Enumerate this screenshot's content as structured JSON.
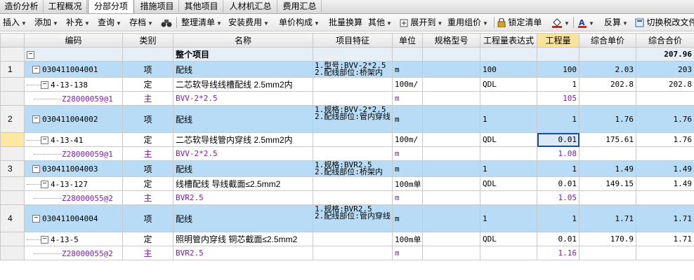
{
  "tabs": [
    "造价分析",
    "工程概况",
    "分部分项",
    "措施项目",
    "其他项目",
    "人材机汇总",
    "费用汇总"
  ],
  "active_tab": 2,
  "toolbar": {
    "insert": "插入",
    "add": "添加",
    "supplement": "补充",
    "query": "查询",
    "archive": "存档",
    "organize": "整理清单",
    "install_fee": "安装费用",
    "unit_composition": "单价构成",
    "batch_convert": "批量换算",
    "other": "其他",
    "expand": "展开到",
    "reuse": "重用组价",
    "lock": "锁定清单",
    "reverse": "反算",
    "switch_tax": "切换税改文件"
  },
  "columns": [
    "编码",
    "类别",
    "名称",
    "项目特征",
    "单位",
    "规格型号",
    "工程量表达式",
    "工程量",
    "综合单价",
    "综合合价"
  ],
  "whole_project": {
    "label": "整个项目",
    "total": "207.96"
  },
  "rows": [
    {
      "num": "1",
      "code": "030411004001",
      "type": "项",
      "name": "配线",
      "feat1": "1.型号:BVV-2*2.5",
      "feat2": "2.配线部位:桥架内",
      "unit": "m",
      "expr": "100",
      "qty": "100",
      "price": "2.03",
      "total": "203"
    },
    {
      "code": "4-13-138",
      "type": "定",
      "name": "二芯软导线线槽配线 2.5mm2内",
      "unit": "100m/",
      "expr": "QDL",
      "qty": "1",
      "price": "202.8",
      "total": "202.8"
    },
    {
      "code": "Z28000059@1",
      "type": "主",
      "name": "BVV-2*2.5",
      "unit": "m",
      "qty": "105"
    },
    {
      "num": "2",
      "code": "030411004002",
      "type": "项",
      "name": "配线",
      "feat1": "1.规格:BVV-2*2.5",
      "feat2": "2.配线部位:管内穿线",
      "unit": "m",
      "expr": "1",
      "qty": "1",
      "price": "1.76",
      "total": "1.76"
    },
    {
      "code": "4-13-41",
      "type": "定",
      "name": "二芯软导线管内穿线 2.5mm2内",
      "unit": "100m/",
      "expr": "QDL",
      "qty": "0.01",
      "price": "175.61",
      "total": "1.76"
    },
    {
      "code": "Z28000059@1",
      "type": "主",
      "name": "BVV-2*2.5",
      "unit": "m",
      "qty": "1.08"
    },
    {
      "num": "3",
      "code": "030411004003",
      "type": "项",
      "name": "配线",
      "feat1": "1.规格:BVR2.5",
      "feat2": "2.配线部位:桥架内",
      "unit": "m",
      "expr": "1",
      "qty": "1",
      "price": "1.49",
      "total": "1.49"
    },
    {
      "code": "4-13-127",
      "type": "定",
      "name": "线槽配线 导线截面≤2.5mm2",
      "unit": "100m单",
      "expr": "QDL",
      "qty": "0.01",
      "price": "149.15",
      "total": "1.49"
    },
    {
      "code": "Z28000055@2",
      "type": "主",
      "name": "BVR2.5",
      "unit": "m",
      "qty": "1.05"
    },
    {
      "num": "4",
      "code": "030411004004",
      "type": "项",
      "name": "配线",
      "feat1": "1.规格:BVR2.5",
      "feat2": "2.配线部位:管内穿线",
      "unit": "m",
      "expr": "1",
      "qty": "1",
      "price": "1.71",
      "total": "1.71"
    },
    {
      "code": "4-13-5",
      "type": "定",
      "name": "照明管内穿线 铜芯截面≤2.5mm2",
      "unit": "100m单",
      "expr": "QDL",
      "qty": "0.01",
      "price": "170.9",
      "total": "1.71"
    },
    {
      "code": "Z28000055@2",
      "type": "主",
      "name": "BVR2.5",
      "unit": "m",
      "qty": "1.16"
    }
  ]
}
